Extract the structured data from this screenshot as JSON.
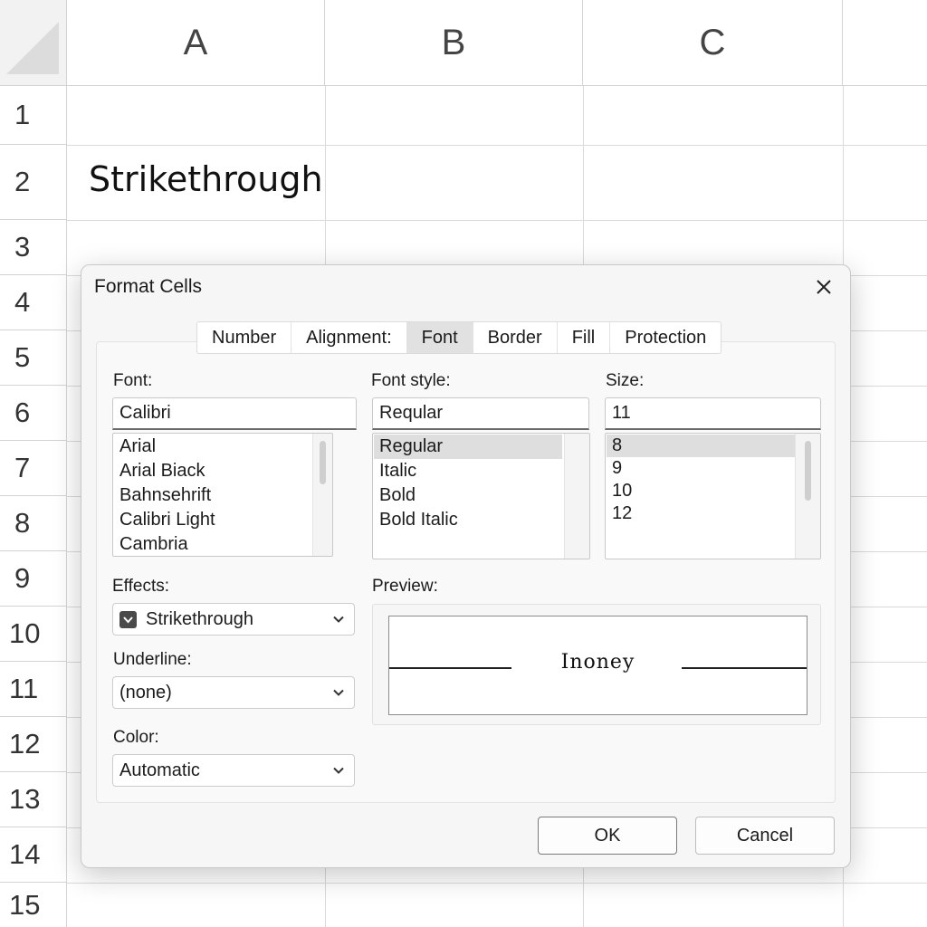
{
  "sheet": {
    "columns": [
      "A",
      "B",
      "C"
    ],
    "rows": [
      "1",
      "2",
      "3",
      "4",
      "5",
      "6",
      "7",
      "8",
      "9",
      "10",
      "11",
      "12",
      "13",
      "14",
      "15"
    ],
    "cell_a2": "Strikethrough"
  },
  "dialog": {
    "title": "Format Cells",
    "tabs": [
      {
        "label": "Number"
      },
      {
        "label": "Alignment:"
      },
      {
        "label": "Font"
      },
      {
        "label": "Border"
      },
      {
        "label": "Fill"
      },
      {
        "label": "Protection"
      }
    ],
    "active_tab": "Font",
    "font": {
      "label": "Font:",
      "value": "Calibri",
      "options": [
        "Arial",
        "Arial Biack",
        "Bahnsehrift",
        "Calibri Light",
        "Cambria"
      ]
    },
    "font_style": {
      "label": "Font style:",
      "value": "Reqular",
      "options": [
        "Regular",
        "Italic",
        "Bold",
        "Bold Italic"
      ],
      "selected": "Regular"
    },
    "size": {
      "label": "Size:",
      "value": "11",
      "options": [
        "8",
        "9",
        "10",
        "12"
      ],
      "selected": "8"
    },
    "effects": {
      "label": "Effects:",
      "value": "Strikethrough",
      "checked": true
    },
    "underline": {
      "label": "Underline:",
      "value": "(none)"
    },
    "color": {
      "label": "Color:",
      "value": "Automatic"
    },
    "preview": {
      "label": "Preview:",
      "text": "Inoney"
    },
    "ok_label": "OK",
    "cancel_label": "Cancel"
  },
  "icons": {
    "close": "close-icon",
    "chevron": "chevron-down-icon",
    "checkbox": "checkbox-checked-icon"
  }
}
